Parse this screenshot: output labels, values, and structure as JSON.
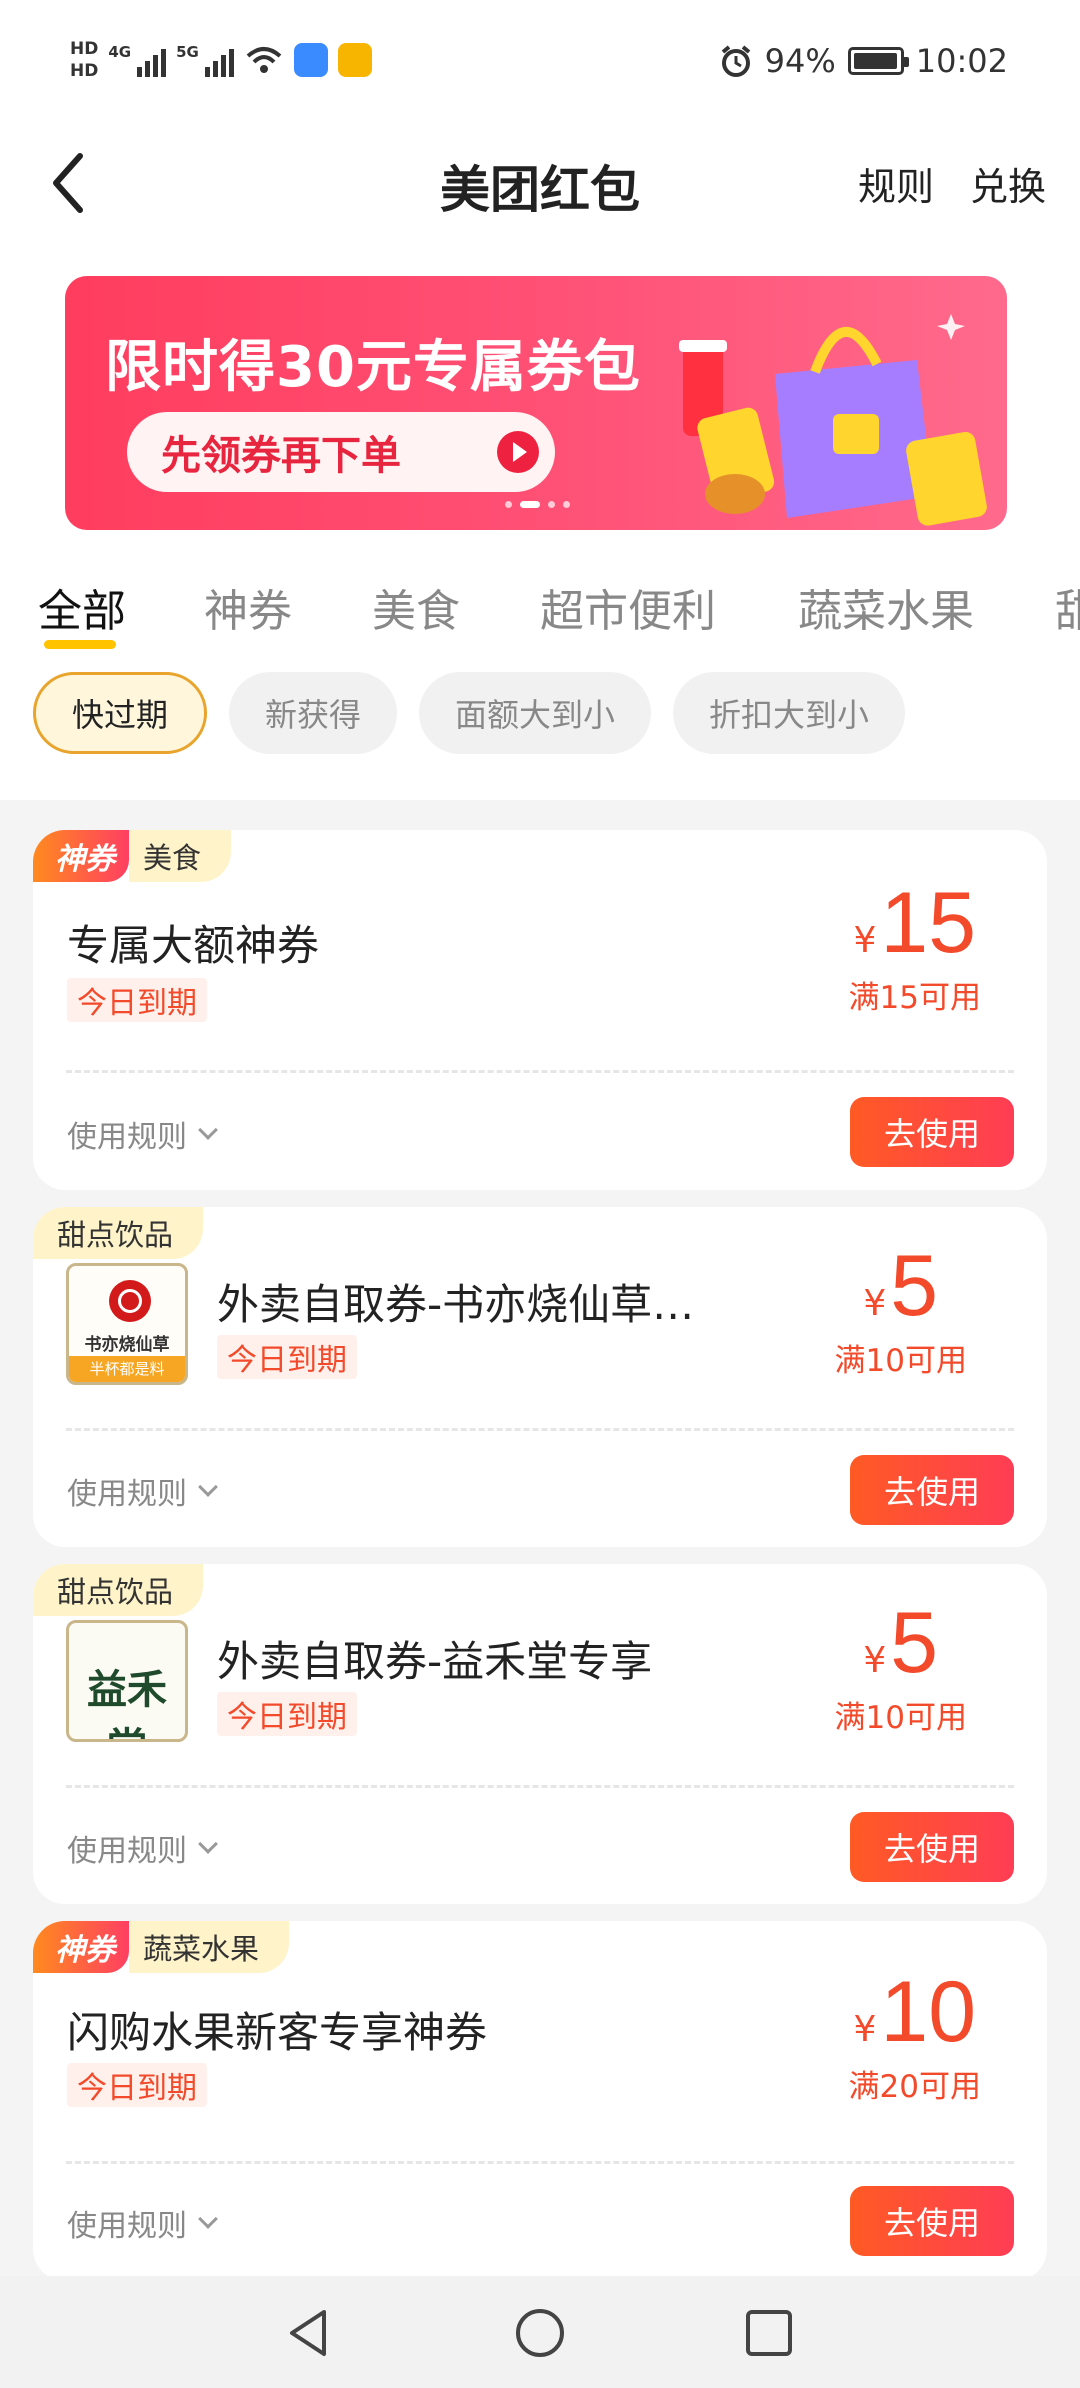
{
  "status_bar": {
    "hd1": "HD",
    "hd2": "HD",
    "net1": "4G",
    "net2": "5G",
    "battery_pct": "94%",
    "time": "10:02",
    "icons": [
      "signal-icon",
      "wifi-icon",
      "app-notification-icon",
      "alarm-icon",
      "battery-icon"
    ]
  },
  "header": {
    "title": "美团红包",
    "rules_link": "规则",
    "exchange_link": "兑换"
  },
  "banner": {
    "title": "限时得30元专属券包",
    "button": "先领券再下单",
    "colors": {
      "bg": "#ff4266",
      "button_text": "#e8253f"
    }
  },
  "tabs": [
    "全部",
    "神券",
    "美食",
    "超市便利",
    "蔬菜水果",
    "甜"
  ],
  "active_tab": "全部",
  "filters": [
    "快过期",
    "新获得",
    "面额大到小",
    "折扣大到小"
  ],
  "active_filter": "快过期",
  "coupons": [
    {
      "god_tag": "神券",
      "category": "美食",
      "name": "专属大额神券",
      "badge": "今日到期",
      "currency": "¥",
      "amount": "15",
      "condition": "满15可用",
      "rule": "使用规则",
      "button": "去使用"
    },
    {
      "category": "甜点饮品",
      "name": "外卖自取券-书亦烧仙草…",
      "badge": "今日到期",
      "currency": "¥",
      "amount": "5",
      "condition": "满10可用",
      "rule": "使用规则",
      "button": "去使用",
      "logo_text": "书亦烧仙草",
      "logo_slogan": "半杯都是料"
    },
    {
      "category": "甜点饮品",
      "name": "外卖自取券-益禾堂专享",
      "badge": "今日到期",
      "currency": "¥",
      "amount": "5",
      "condition": "满10可用",
      "rule": "使用规则",
      "button": "去使用",
      "logo_text": "益禾堂"
    },
    {
      "god_tag": "神券",
      "category": "蔬菜水果",
      "name": "闪购水果新客专享神券",
      "badge": "今日到期",
      "currency": "¥",
      "amount": "10",
      "condition": "满20可用",
      "rule": "使用规则",
      "button": "去使用"
    }
  ],
  "colors": {
    "accent": "#ffc300",
    "price": "#f24a2a",
    "use_button": "#ff4a3c"
  }
}
